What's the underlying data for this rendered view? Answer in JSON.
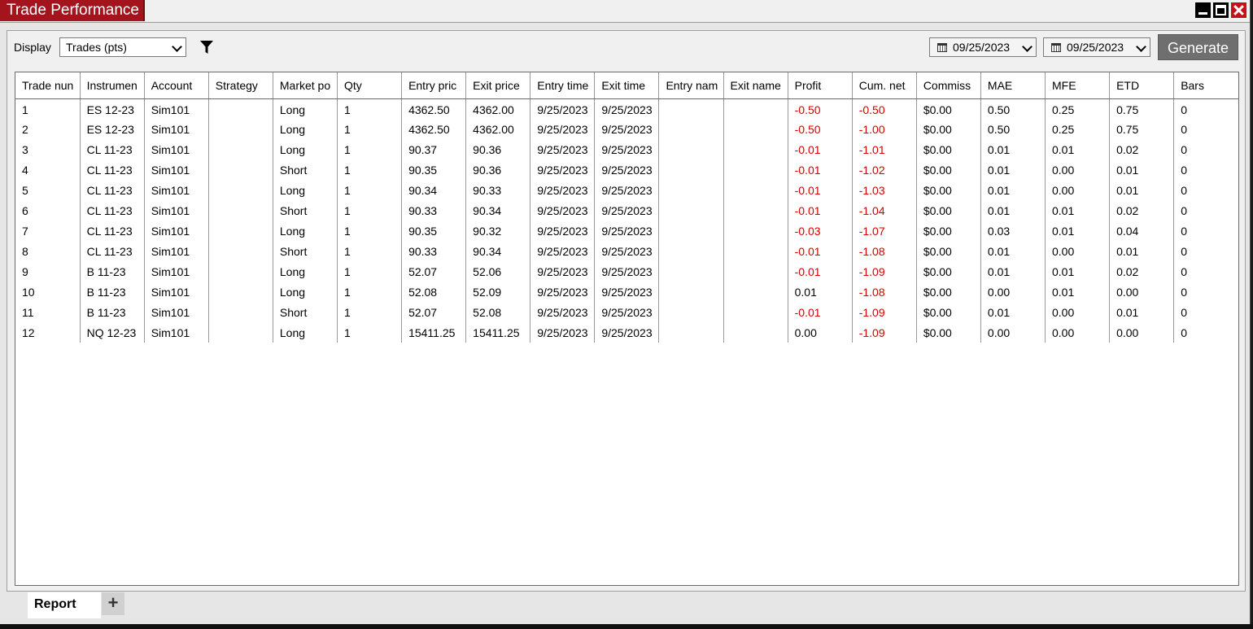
{
  "window": {
    "title": "Trade Performance",
    "controls": [
      "minimize-icon",
      "maximize-icon",
      "close-icon"
    ]
  },
  "toolbar": {
    "display_label": "Display",
    "display_value": "Trades (pts)",
    "start_date": "09/25/2023",
    "end_date": "09/25/2023",
    "generate_label": "Generate"
  },
  "colors": {
    "title_tab": "#a4141c",
    "negative": "#d40000",
    "generate_button": "#6f6f6f"
  },
  "table": {
    "columns": [
      "Trade nun",
      "Instrumen",
      "Account",
      "Strategy",
      "Market po",
      "Qty",
      "Entry pric",
      "Exit price",
      "Entry time",
      "Exit time",
      "Entry nam",
      "Exit name",
      "Profit",
      "Cum. net",
      "Commiss",
      "MAE",
      "MFE",
      "ETD",
      "Bars"
    ],
    "rows": [
      [
        "1",
        "ES 12-23",
        "Sim101",
        "",
        "Long",
        "1",
        "4362.50",
        "4362.00",
        "9/25/2023",
        "9/25/2023",
        "",
        "",
        "-0.50",
        "-0.50",
        "$0.00",
        "0.50",
        "0.25",
        "0.75",
        "0"
      ],
      [
        "2",
        "ES 12-23",
        "Sim101",
        "",
        "Long",
        "1",
        "4362.50",
        "4362.00",
        "9/25/2023",
        "9/25/2023",
        "",
        "",
        "-0.50",
        "-1.00",
        "$0.00",
        "0.50",
        "0.25",
        "0.75",
        "0"
      ],
      [
        "3",
        "CL 11-23",
        "Sim101",
        "",
        "Long",
        "1",
        "90.37",
        "90.36",
        "9/25/2023",
        "9/25/2023",
        "",
        "",
        "-0.01",
        "-1.01",
        "$0.00",
        "0.01",
        "0.01",
        "0.02",
        "0"
      ],
      [
        "4",
        "CL 11-23",
        "Sim101",
        "",
        "Short",
        "1",
        "90.35",
        "90.36",
        "9/25/2023",
        "9/25/2023",
        "",
        "",
        "-0.01",
        "-1.02",
        "$0.00",
        "0.01",
        "0.00",
        "0.01",
        "0"
      ],
      [
        "5",
        "CL 11-23",
        "Sim101",
        "",
        "Long",
        "1",
        "90.34",
        "90.33",
        "9/25/2023",
        "9/25/2023",
        "",
        "",
        "-0.01",
        "-1.03",
        "$0.00",
        "0.01",
        "0.00",
        "0.01",
        "0"
      ],
      [
        "6",
        "CL 11-23",
        "Sim101",
        "",
        "Short",
        "1",
        "90.33",
        "90.34",
        "9/25/2023",
        "9/25/2023",
        "",
        "",
        "-0.01",
        "-1.04",
        "$0.00",
        "0.01",
        "0.01",
        "0.02",
        "0"
      ],
      [
        "7",
        "CL 11-23",
        "Sim101",
        "",
        "Long",
        "1",
        "90.35",
        "90.32",
        "9/25/2023",
        "9/25/2023",
        "",
        "",
        "-0.03",
        "-1.07",
        "$0.00",
        "0.03",
        "0.01",
        "0.04",
        "0"
      ],
      [
        "8",
        "CL 11-23",
        "Sim101",
        "",
        "Short",
        "1",
        "90.33",
        "90.34",
        "9/25/2023",
        "9/25/2023",
        "",
        "",
        "-0.01",
        "-1.08",
        "$0.00",
        "0.01",
        "0.00",
        "0.01",
        "0"
      ],
      [
        "9",
        "B 11-23",
        "Sim101",
        "",
        "Long",
        "1",
        "52.07",
        "52.06",
        "9/25/2023",
        "9/25/2023",
        "",
        "",
        "-0.01",
        "-1.09",
        "$0.00",
        "0.01",
        "0.01",
        "0.02",
        "0"
      ],
      [
        "10",
        "B 11-23",
        "Sim101",
        "",
        "Long",
        "1",
        "52.08",
        "52.09",
        "9/25/2023",
        "9/25/2023",
        "",
        "",
        "0.01",
        "-1.08",
        "$0.00",
        "0.00",
        "0.01",
        "0.00",
        "0"
      ],
      [
        "11",
        "B 11-23",
        "Sim101",
        "",
        "Short",
        "1",
        "52.07",
        "52.08",
        "9/25/2023",
        "9/25/2023",
        "",
        "",
        "-0.01",
        "-1.09",
        "$0.00",
        "0.01",
        "0.00",
        "0.01",
        "0"
      ],
      [
        "12",
        "NQ 12-23",
        "Sim101",
        "",
        "Long",
        "1",
        "15411.25",
        "15411.25",
        "9/25/2023",
        "9/25/2023",
        "",
        "",
        "0.00",
        "-1.09",
        "$0.00",
        "0.00",
        "0.00",
        "0.00",
        "0"
      ]
    ]
  },
  "tabs": {
    "report_label": "Report",
    "add_label": "+"
  }
}
